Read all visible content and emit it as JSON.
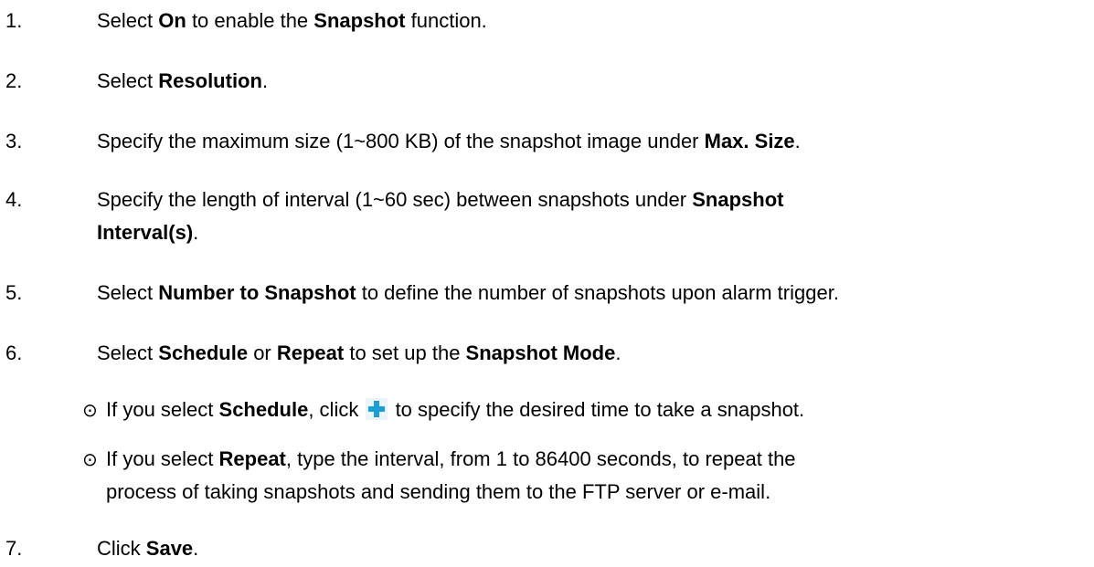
{
  "steps": [
    {
      "num": "1.",
      "parts": [
        "Select ",
        "On",
        " to enable the ",
        "Snapshot",
        " function."
      ]
    },
    {
      "num": "2.",
      "parts": [
        "Select ",
        "Resolution",
        "."
      ]
    },
    {
      "num": "3.",
      "parts": [
        "Specify the maximum size (1~800 KB) of the snapshot image under ",
        "Max. Size",
        "."
      ]
    },
    {
      "num": "4.",
      "line1": "Specify the length of interval (1~60 sec) between snapshots under ",
      "line1_bold": "Snapshot",
      "line2_bold": "Interval(s)",
      "line2_end": "."
    },
    {
      "num": "5.",
      "parts": [
        "Select ",
        "Number to Snapshot",
        " to define the number of snapshots upon alarm trigger."
      ]
    },
    {
      "num": "6.",
      "parts": [
        "Select ",
        "Schedule",
        " or ",
        "Repeat",
        " to set up the ",
        "Snapshot Mode",
        "."
      ]
    },
    {
      "num": "7.",
      "parts": [
        "Click ",
        "Save",
        "."
      ]
    }
  ],
  "bullets": [
    {
      "mark": "⊙",
      "parts": [
        "If you select ",
        "Schedule",
        ", click ",
        " to specify the desired time to take a snapshot."
      ]
    },
    {
      "mark": "⊙",
      "line1_a": "If you select ",
      "line1_bold": "Repeat",
      "line1_b": ", type the interval, from 1 to 86400 seconds, to repeat the",
      "line2": "process of taking snapshots and sending them to the FTP server or e-mail."
    }
  ],
  "icons": {
    "add": "plus-icon",
    "add_color": "#1a9fd6"
  }
}
